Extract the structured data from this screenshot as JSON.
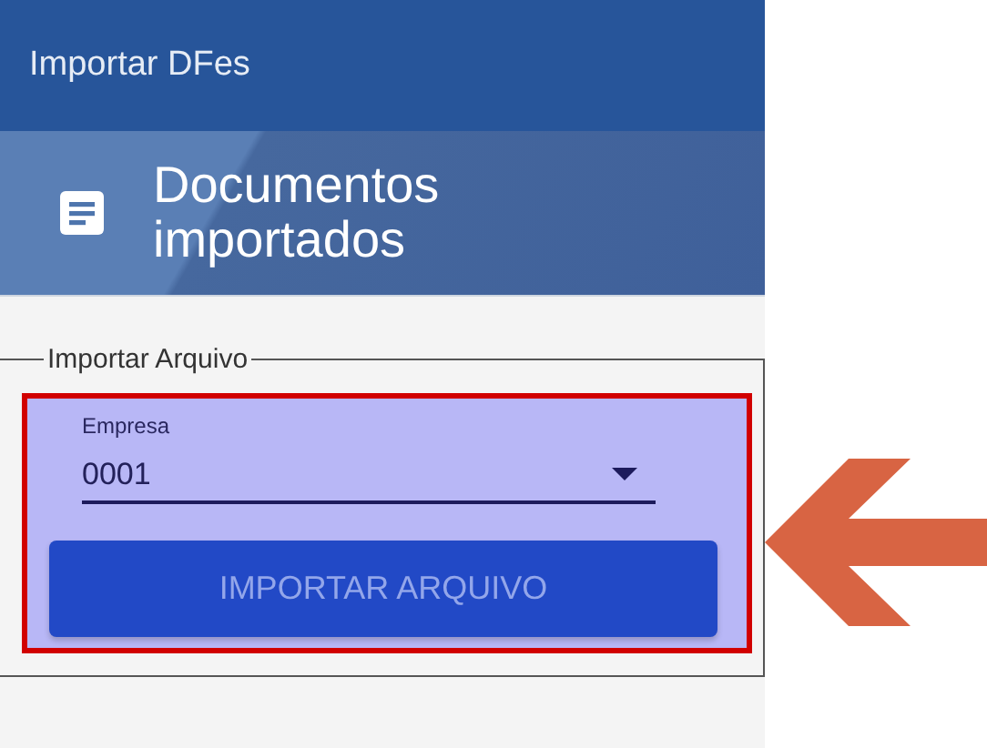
{
  "app_bar": {
    "title": "Importar DFes"
  },
  "header": {
    "title": "Documentos importados"
  },
  "fieldset": {
    "legend": "Importar Arquivo",
    "select": {
      "label": "Empresa",
      "value": "0001"
    },
    "button": {
      "label": "IMPORTAR ARQUIVO",
      "disabled": true
    }
  }
}
